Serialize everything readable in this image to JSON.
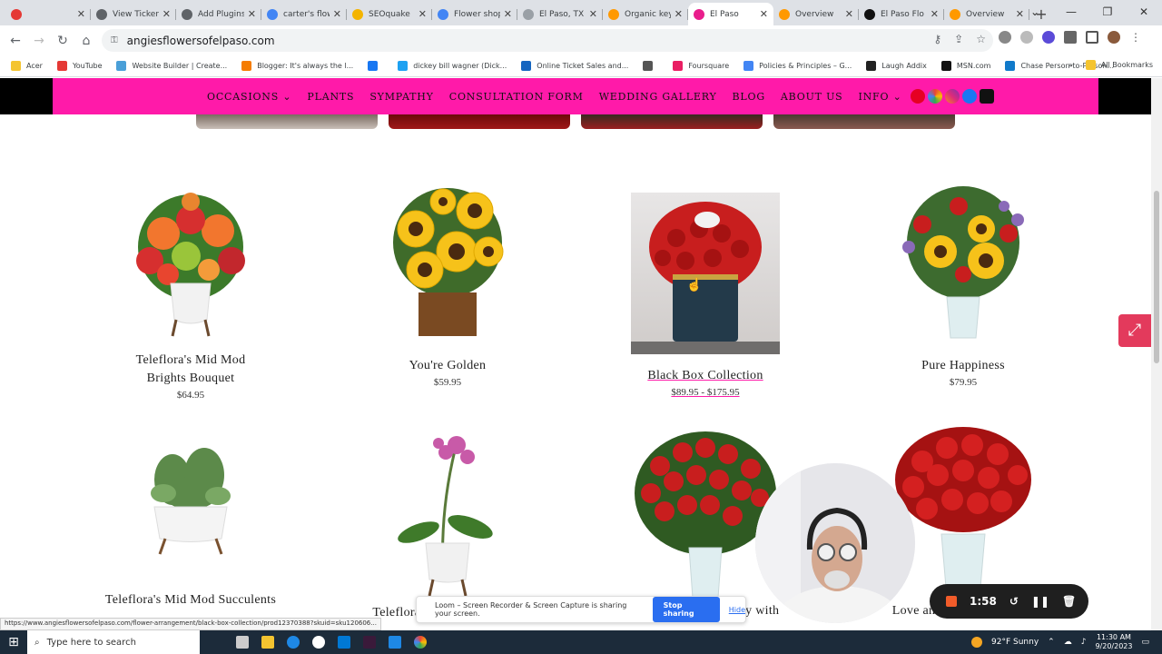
{
  "browser": {
    "tabs": [
      {
        "title": "",
        "fav": "#e53935"
      },
      {
        "title": "View Ticker",
        "fav": "#5f6368"
      },
      {
        "title": "Add Plugins",
        "fav": "#5f6368"
      },
      {
        "title": "carter's flow",
        "fav": "#4285f4"
      },
      {
        "title": "SEOquake",
        "fav": "#f4b400"
      },
      {
        "title": "Flower shop",
        "fav": "#4285f4"
      },
      {
        "title": "El Paso, TX",
        "fav": "#9aa0a6"
      },
      {
        "title": "Organic key",
        "fav": "#ff9900"
      },
      {
        "title": "El Paso",
        "fav": "#e91e8c",
        "active": true
      },
      {
        "title": "Overview",
        "fav": "#ff9900"
      },
      {
        "title": "El Paso Flo",
        "fav": "#111111"
      },
      {
        "title": "Overview",
        "fav": "#ff9900"
      }
    ],
    "url": "angiesflowersofelpaso.com",
    "bookmarks": [
      "Acer",
      "YouTube",
      "Website Builder | Create...",
      "Blogger: It's always the l...",
      "",
      "dickey bill wagner (Dick...",
      "Online Ticket Sales and...",
      "",
      "Foursquare",
      "Policies & Principles – G...",
      "Laugh Addix",
      "MSN.com",
      "Chase Person-to-Person..."
    ],
    "all_bookmarks": "All Bookmarks"
  },
  "site": {
    "nav": [
      "OCCASIONS",
      "PLANTS",
      "SYMPATHY",
      "CONSULTATION FORM",
      "WEDDING GALLERY",
      "BLOG",
      "ABOUT US",
      "INFO"
    ],
    "products_row1": [
      {
        "name1": "Teleflora's Mid Mod",
        "name2": "Brights Bouquet",
        "price": "$64.95"
      },
      {
        "name1": "You're Golden",
        "name2": "",
        "price": "$59.95"
      },
      {
        "name1": "Black Box Collection",
        "name2": "",
        "price": "$89.95 - $175.95"
      },
      {
        "name1": "Pure Happiness",
        "name2": "",
        "price": "$79.95"
      }
    ],
    "products_row2": [
      {
        "name": "Teleflora's Mid Mod Succulents"
      },
      {
        "name": "Teleflora's Mid Mod Orchid"
      },
      {
        "name": "Overwhelming Beauty with"
      },
      {
        "name": "Love and Devotion - Long"
      }
    ]
  },
  "loom": {
    "text": "Loom – Screen Recorder & Screen Capture is sharing your screen.",
    "stop": "Stop sharing",
    "hide": "Hide"
  },
  "recorder": {
    "time": "1:58"
  },
  "status_url": "https://www.angiesflowersofelpaso.com/flower-arrangement/black-box-collection/prod12370388?skuid=sku120606...",
  "taskbar": {
    "search": "Type here to search",
    "weather": "92°F  Sunny",
    "time": "11:30 AM",
    "date": "9/20/2023"
  }
}
